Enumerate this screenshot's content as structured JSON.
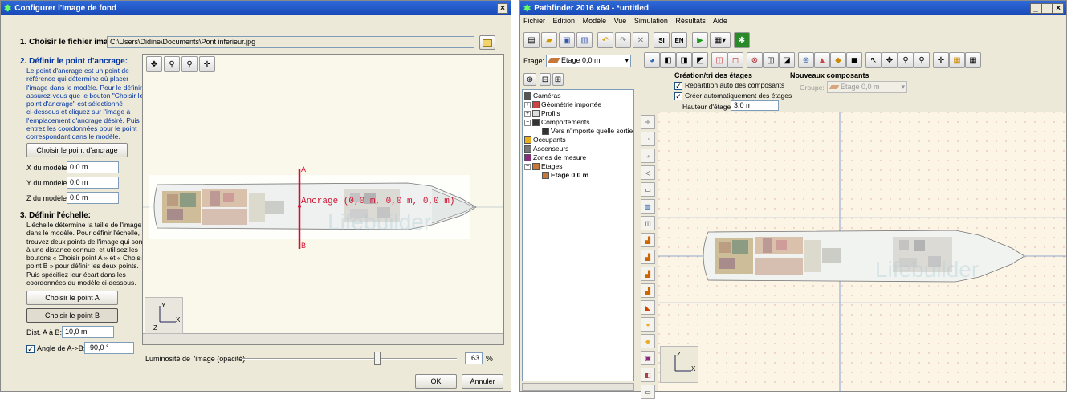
{
  "left": {
    "title": "Configurer l'Image de fond",
    "close": "×",
    "step1_label": "1. Choisir le fichier image:",
    "file_path": "C:\\Users\\Didine\\Documents\\Pont inferieur.jpg",
    "step2_label": "2. Définir le point d'ancrage:",
    "step2_help": [
      "Le point d'ancrage est un point de",
      "référence qui détermine où placer",
      "l'image dans le modèle. Pour le définir,",
      "assurez-vous que le bouton \"Choisir le",
      "point d'ancrage\" est sélectionné",
      "ci-dessous et cliquez sur l'image à",
      "l'emplacement d'ancrage désiré. Puis",
      "entrez les coordonnées pour le point",
      "correspondant dans le modèle."
    ],
    "choose_anchor": "Choisir le point d'ancrage",
    "x_label": "X du modèle:",
    "x_value": "0,0 m",
    "y_label": "Y du modèle:",
    "y_value": "0,0 m",
    "z_label": "Z du modèle:",
    "z_value": "0,0 m",
    "step3_label": "3. Définir l'échelle:",
    "step3_help": [
      "L'échelle détermine la taille de l'image",
      "dans le modèle. Pour définir l'échelle,",
      "trouvez deux points de l'image qui sont",
      "à une distance connue, et utilisez les",
      "boutons « Choisir point A » et « Choisir",
      "point B » pour définir les deux points.",
      "Puis spécifiez leur écart dans les",
      "coordonnées du modèle ci-dessous."
    ],
    "choose_a": "Choisir le point A",
    "choose_b": "Choisir le point B",
    "dist_label": "Dist. A à B:",
    "dist_value": "10,0 m",
    "angle_label": "Angle de A->B:",
    "angle_value": "-90,0 °",
    "anchor_text": "Ancrage (0,0 m, 0,0 m, 0,0 m)",
    "point_a": "A",
    "point_b": "B",
    "axis_y": "Y",
    "axis_x": "X",
    "axis_z": "Z",
    "brightness_label": "Luminosité de l'image (opacité):",
    "brightness_value": "63",
    "brightness_pct": 63,
    "percent": "%",
    "ok": "OK",
    "cancel": "Annuler"
  },
  "right": {
    "title": "Pathfinder 2016 x64 - *untitled",
    "menu": [
      "Fichier",
      "Edition",
      "Modèle",
      "Vue",
      "Simulation",
      "Résultats",
      "Aide"
    ],
    "si": "SI",
    "en": "EN",
    "etage_label": "Etage:",
    "etage_value": "Etage 0,0 m",
    "tree": [
      "Caméras",
      "Géométrie importée",
      "Profils",
      "Comportements",
      "Vers n'importe quelle sortie",
      "Occupants",
      "Ascenseurs",
      "Zones de mesure",
      "Etages",
      "Etage 0,0 m"
    ],
    "creation_title": "Création/tri des étages",
    "auto_repartition": "Répartition auto des composants",
    "auto_create": "Créer automatiquement des étages",
    "height_label": "Hauteur d'étage:",
    "height_value": "3,0 m",
    "new_comp_title": "Nouveaux composants",
    "group_label": "Groupe:",
    "group_value": "Etage 0,0 m",
    "axis_z": "Z",
    "axis_x": "X"
  }
}
